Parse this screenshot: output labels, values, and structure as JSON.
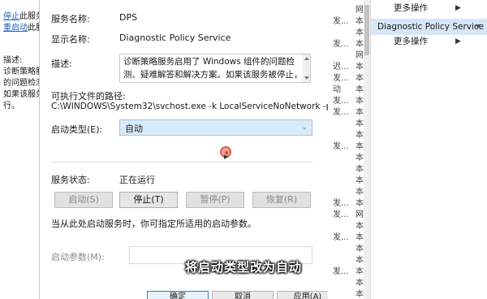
{
  "left_panel": {
    "stop_link": "停止",
    "stop_text": "此服务",
    "restart_link": "重启动",
    "restart_text": "此服",
    "desc_label": "描述:",
    "desc_lines": [
      "诊断策略服",
      "的问题检测",
      "如果该服务",
      "行。"
    ]
  },
  "dialog": {
    "service_name_label": "服务名称:",
    "service_name_value": "DPS",
    "display_name_label": "显示名称:",
    "display_name_value": "Diagnostic Policy Service",
    "description_label": "描述:",
    "description_text": "诊断策略服务启用了 Windows 组件的问题检测、疑难解答和解决方案。如果该服务被停止，诊断将不再运行",
    "exec_path_label": "可执行文件的路径:",
    "exec_path_value": "C:\\WINDOWS\\System32\\svchost.exe -k LocalServiceNoNetwork -p",
    "startup_type_label": "启动类型(E):",
    "startup_type_value": "自动",
    "service_status_label": "服务状态:",
    "service_status_value": "正在运行",
    "buttons": {
      "start": "启动(S)",
      "stop": "停止(T)",
      "pause": "暂停(P)",
      "resume": "恢复(R)"
    },
    "hint_text": "当从此处启动服务时，你可指定所适用的启动参数。",
    "start_params_label": "启动参数(M):",
    "bottom_buttons": {
      "ok": "确定",
      "cancel": "取消",
      "apply": "应用(A)"
    }
  },
  "list_rows": [
    {
      "c1": "",
      "c2": "网"
    },
    {
      "c1": "发...",
      "c2": "本"
    },
    {
      "c1": "",
      "c2": "本"
    },
    {
      "c1": "发...",
      "c2": "本"
    },
    {
      "c1": "",
      "c2": "网"
    },
    {
      "c1": "迟...",
      "c2": "本"
    },
    {
      "c1": "发...",
      "c2": "本"
    },
    {
      "c1": "动",
      "c2": "本"
    },
    {
      "c1": "发...",
      "c2": "本"
    },
    {
      "c1": "发...",
      "c2": "本"
    },
    {
      "c1": "",
      "c2": "本"
    },
    {
      "c1": "",
      "c2": "本"
    },
    {
      "c1": "发...",
      "c2": "本"
    },
    {
      "c1": "",
      "c2": "本"
    },
    {
      "c1": "",
      "c2": "本"
    },
    {
      "c1": "",
      "c2": "本"
    },
    {
      "c1": "",
      "c2": "本"
    },
    {
      "c1": "发...",
      "c2": "本"
    },
    {
      "c1": "发...",
      "c2": "网"
    },
    {
      "c1": "",
      "c2": "本"
    },
    {
      "c1": "发...",
      "c2": "本"
    },
    {
      "c1": "",
      "c2": "本"
    },
    {
      "c1": "",
      "c2": "本"
    },
    {
      "c1": "发...",
      "c2": "本"
    },
    {
      "c1": "",
      "c2": "本"
    },
    {
      "c1": "",
      "c2": "本"
    }
  ],
  "action_pane": {
    "more_actions_1": "更多操作",
    "selected_service": "Diagnostic Policy Service",
    "more_actions_2": "更多操作"
  },
  "subtitle": "将启动类型改为自动",
  "colors": {
    "selection": "#d5e6f7",
    "link": "#1a5fb4",
    "cursor_highlight": "#e05a45"
  }
}
